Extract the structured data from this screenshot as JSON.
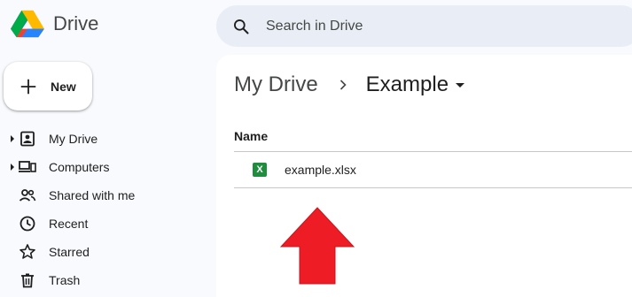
{
  "app": {
    "name": "Drive"
  },
  "search": {
    "placeholder": "Search in Drive"
  },
  "new_button": {
    "label": "New"
  },
  "sidebar": {
    "items": [
      {
        "label": "My Drive",
        "icon": "my-drive-icon"
      },
      {
        "label": "Computers",
        "icon": "computers-icon"
      },
      {
        "label": "Shared with me",
        "icon": "shared-icon"
      },
      {
        "label": "Recent",
        "icon": "clock-icon"
      },
      {
        "label": "Starred",
        "icon": "star-icon"
      },
      {
        "label": "Trash",
        "icon": "trash-icon"
      }
    ]
  },
  "breadcrumb": {
    "root": "My Drive",
    "current": "Example"
  },
  "file_list": {
    "column_name": "Name",
    "files": [
      {
        "name": "example.xlsx",
        "type_glyph": "X"
      }
    ]
  },
  "colors": {
    "accent_arrow": "#ee1c25",
    "sheets_green": "#1e8e3e"
  }
}
